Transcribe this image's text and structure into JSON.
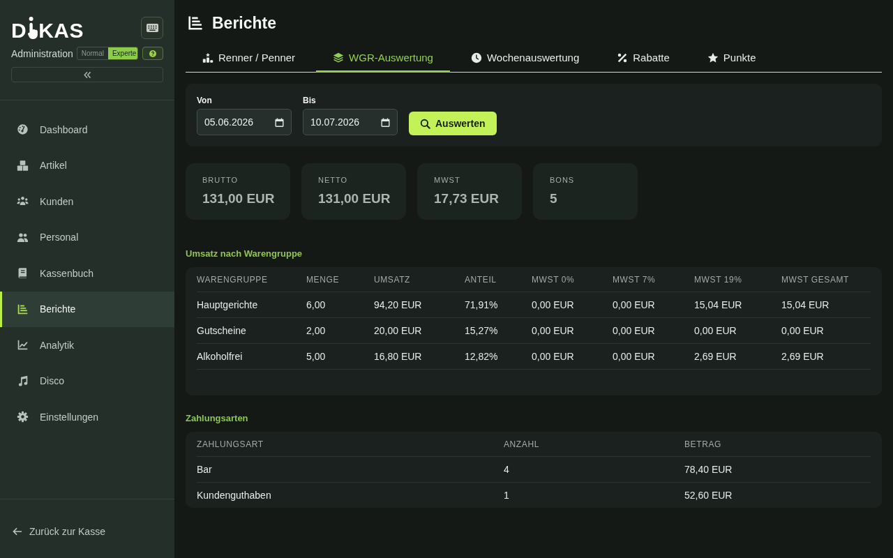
{
  "sidebar": {
    "logo": {
      "text_before": "D",
      "text_after": "KAS"
    },
    "subtitle": "Administration",
    "mode_options": [
      {
        "label": "Normal",
        "selected": false
      },
      {
        "label": "Experte",
        "selected": true
      }
    ],
    "nav_items": [
      {
        "label": "Dashboard",
        "selected": false
      },
      {
        "label": "Artikel",
        "selected": false
      },
      {
        "label": "Kunden",
        "selected": false
      },
      {
        "label": "Personal",
        "selected": false
      },
      {
        "label": "Kassenbuch",
        "selected": false
      },
      {
        "label": "Berichte",
        "selected": true
      },
      {
        "label": "Analytik",
        "selected": false
      },
      {
        "label": "Disco",
        "selected": false
      },
      {
        "label": "Einstellungen",
        "selected": false
      }
    ],
    "back_link": "Zurück zur Kasse"
  },
  "page": {
    "title": "Berichte"
  },
  "tabs": [
    {
      "label": "Renner / Penner",
      "selected": false
    },
    {
      "label": "WGR-Auswertung",
      "selected": true
    },
    {
      "label": "Wochenauswertung",
      "selected": false
    },
    {
      "label": "Rabatte",
      "selected": false
    },
    {
      "label": "Punkte",
      "selected": false
    }
  ],
  "filter": {
    "fields": [
      {
        "label": "Von",
        "value": "05.06.2026"
      },
      {
        "label": "Bis",
        "value": "10.07.2026"
      }
    ],
    "button": "Auswerten"
  },
  "stats": [
    {
      "label": "BRUTTO",
      "value": "131,00 EUR"
    },
    {
      "label": "NETTO",
      "value": "131,00 EUR"
    },
    {
      "label": "MWST",
      "value": "17,73 EUR"
    },
    {
      "label": "BONS",
      "value": "5"
    }
  ],
  "sections": [
    {
      "title": "Umsatz nach Warengruppe",
      "table": {
        "columns": [
          "WARENGRUPPE",
          "MENGE",
          "UMSATZ",
          "ANTEIL",
          "MWST 0%",
          "MWST 7%",
          "MWST 19%",
          "MWST GESAMT"
        ],
        "rows": [
          [
            "Hauptgerichte",
            "6,00",
            "94,20 EUR",
            "71,91%",
            "0,00 EUR",
            "0,00 EUR",
            "15,04 EUR",
            "15,04 EUR"
          ],
          [
            "Gutscheine",
            "2,00",
            "20,00 EUR",
            "15,27%",
            "0,00 EUR",
            "0,00 EUR",
            "0,00 EUR",
            "0,00 EUR"
          ],
          [
            "Alkoholfrei",
            "5,00",
            "16,80 EUR",
            "12,82%",
            "0,00 EUR",
            "0,00 EUR",
            "2,69 EUR",
            "2,69 EUR"
          ]
        ]
      }
    },
    {
      "title": "Zahlungsarten",
      "table": {
        "columns": [
          "ZAHLUNGSART",
          "ANZAHL",
          "BETRAG"
        ],
        "rows": [
          [
            "Bar",
            "4",
            "78,40 EUR"
          ],
          [
            "Kundenguthaben",
            "1",
            "52,60 EUR"
          ]
        ]
      }
    }
  ]
}
